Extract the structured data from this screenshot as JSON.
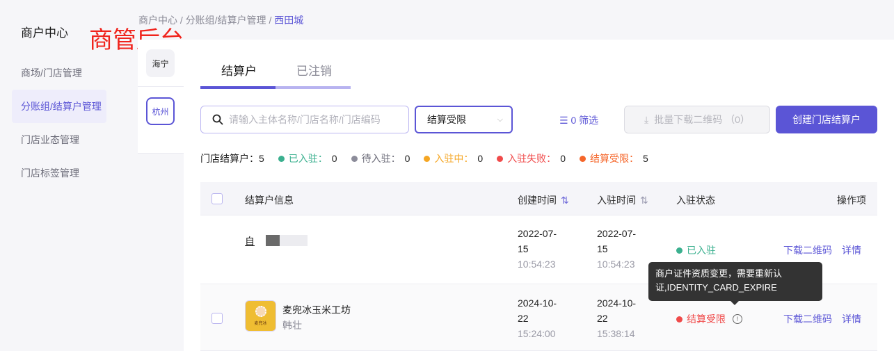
{
  "sidebar": {
    "title": "商户中心",
    "watermark": "商管后台",
    "items": [
      {
        "label": "商场/门店管理"
      },
      {
        "label": "分账组/结算户管理"
      },
      {
        "label": "门店业态管理"
      },
      {
        "label": "门店标签管理"
      }
    ]
  },
  "breadcrumb": {
    "items": [
      "商户中心",
      "分账组/结算户管理"
    ],
    "current": "西田城",
    "sep": "/"
  },
  "cities": [
    "海宁",
    "杭州"
  ],
  "tabs": [
    "结算户",
    "已注销"
  ],
  "toolbar": {
    "search_placeholder": "请输入主体名称/门店名称/门店编码",
    "select_value": "结算受限",
    "filter_label": "0 筛选",
    "batch_label": "批量下载二维码 （0）",
    "create_label": "创建门店结算户"
  },
  "stats": [
    {
      "label": "门店结算户：",
      "value": "5",
      "color": ""
    },
    {
      "label": "已入驻：",
      "value": "0",
      "color": "#3bb08f"
    },
    {
      "label": "待入驻：",
      "value": "0",
      "color": "#8c8c9a"
    },
    {
      "label": "入驻中：",
      "value": "0",
      "color": "#f5a623"
    },
    {
      "label": "入驻失败：",
      "value": "0",
      "color": "#f04a4a"
    },
    {
      "label": "结算受限：",
      "value": "5",
      "color": "#f5662a"
    }
  ],
  "table": {
    "headers": {
      "info": "结算户信息",
      "created": "创建时间",
      "settled": "入驻时间",
      "status": "入驻状态",
      "actions": "操作项"
    },
    "rows": [
      {
        "name": "自",
        "sub": "",
        "created_date1": "2022-07-",
        "created_date2": "15",
        "created_time": "10:54:23",
        "settled_date1": "2022-07-",
        "settled_date2": "15",
        "settled_time": "10:54:23",
        "status": "已入驻",
        "status_color": "#3bb08f",
        "action1": "下载二维码",
        "action2": "详情"
      },
      {
        "name": "麦兜冰玉米工坊",
        "sub": "韩壮",
        "created_date1": "2024-10-",
        "created_date2": "22",
        "created_time": "15:24:00",
        "settled_date1": "2024-10-",
        "settled_date2": "22",
        "settled_time": "15:38:14",
        "status": "结算受限",
        "status_color": "#f04a4a",
        "action1": "下载二维码",
        "action2": "详情",
        "logo_text": "麦兜冰"
      }
    ]
  },
  "tooltip": {
    "text": "商户证件资质变更，需要重新认证,IDENTITY_CARD_EXPIRE"
  }
}
